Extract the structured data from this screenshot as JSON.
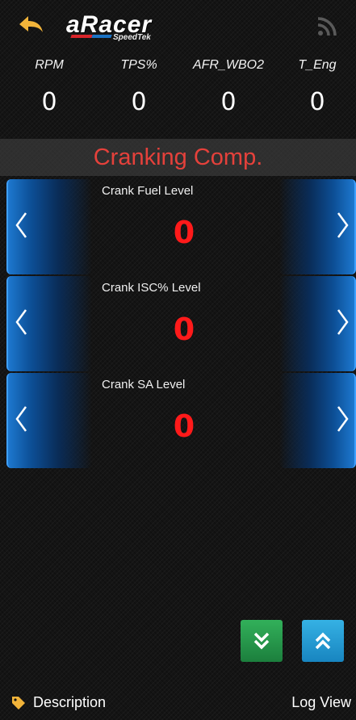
{
  "header": {
    "logo_text": "aRacer",
    "logo_subtext": "SpeedTek",
    "icons": {
      "back": "back-arrow-icon",
      "feed": "rss-icon"
    },
    "colors": {
      "back_arrow": "#f2b43a",
      "logo_red": "#d8242a",
      "logo_blue": "#1b72c4"
    }
  },
  "sensors": [
    {
      "label": "RPM",
      "value": "0"
    },
    {
      "label": "TPS%",
      "value": "0"
    },
    {
      "label": "AFR_WBO2",
      "value": "0"
    },
    {
      "label": "T_Eng",
      "value": "0"
    }
  ],
  "section": {
    "title": "Cranking Comp.",
    "color": "#e5413b"
  },
  "params": [
    {
      "label": "Crank Fuel Level",
      "value": "0"
    },
    {
      "label": "Crank ISC% Level",
      "value": "0"
    },
    {
      "label": "Crank SA Level",
      "value": "0"
    }
  ],
  "param_value_color": "#ff1a1a",
  "controls": {
    "scroll_down_icon": "double-chevron-down-icon",
    "scroll_up_icon": "double-chevron-up-icon",
    "down_color": "#27a04d",
    "up_color": "#23a0d8"
  },
  "footer": {
    "description_label": "Description",
    "log_view_label": "Log View",
    "tag_icon": "tag-icon",
    "tag_color": "#f2b43a"
  }
}
